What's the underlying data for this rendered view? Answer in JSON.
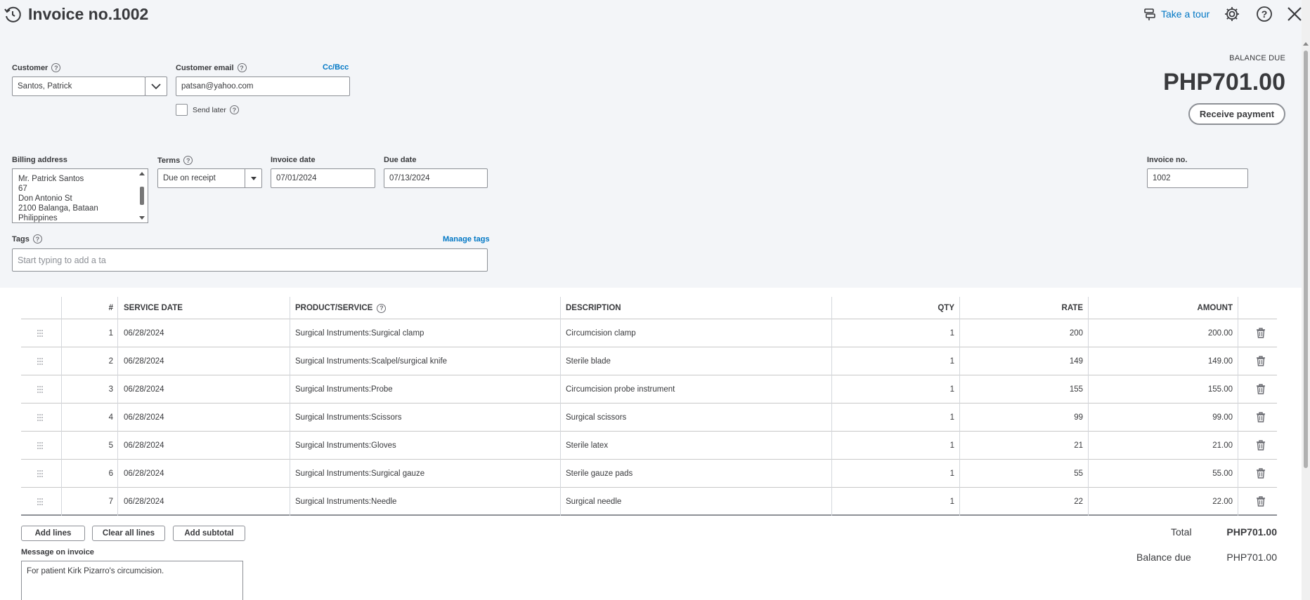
{
  "header": {
    "title": "Invoice no.1002",
    "tour_label": "Take a tour"
  },
  "customer": {
    "label": "Customer",
    "value": "Santos, Patrick"
  },
  "email": {
    "label": "Customer email",
    "value": "patsan@yahoo.com",
    "cc_bcc": "Cc/Bcc",
    "send_later": "Send later"
  },
  "balance": {
    "label": "BALANCE DUE",
    "amount": "PHP701.00",
    "receive_payment": "Receive payment"
  },
  "billing": {
    "label": "Billing address",
    "lines": [
      "Mr. Patrick Santos",
      "67",
      "Don Antonio St",
      "2100 Balanga, Bataan",
      "Philippines"
    ]
  },
  "terms": {
    "label": "Terms",
    "value": "Due on receipt"
  },
  "invoice_date": {
    "label": "Invoice date",
    "value": "07/01/2024"
  },
  "due_date": {
    "label": "Due date",
    "value": "07/13/2024"
  },
  "invoice_no": {
    "label": "Invoice no.",
    "value": "1002"
  },
  "tags": {
    "label": "Tags",
    "manage": "Manage tags",
    "placeholder": "Start typing to add a ta"
  },
  "table": {
    "headers": {
      "num": "#",
      "date": "SERVICE DATE",
      "product": "PRODUCT/SERVICE",
      "description": "DESCRIPTION",
      "qty": "QTY",
      "rate": "RATE",
      "amount": "AMOUNT"
    },
    "rows": [
      {
        "num": "1",
        "date": "06/28/2024",
        "product": "Surgical Instruments:Surgical clamp",
        "description": "Circumcision clamp",
        "qty": "1",
        "rate": "200",
        "amount": "200.00"
      },
      {
        "num": "2",
        "date": "06/28/2024",
        "product": "Surgical Instruments:Scalpel/surgical knife",
        "description": "Sterile blade",
        "qty": "1",
        "rate": "149",
        "amount": "149.00"
      },
      {
        "num": "3",
        "date": "06/28/2024",
        "product": "Surgical Instruments:Probe",
        "description": "Circumcision probe instrument",
        "qty": "1",
        "rate": "155",
        "amount": "155.00"
      },
      {
        "num": "4",
        "date": "06/28/2024",
        "product": "Surgical Instruments:Scissors",
        "description": "Surgical scissors",
        "qty": "1",
        "rate": "99",
        "amount": "99.00"
      },
      {
        "num": "5",
        "date": "06/28/2024",
        "product": "Surgical Instruments:Gloves",
        "description": "Sterile latex",
        "qty": "1",
        "rate": "21",
        "amount": "21.00"
      },
      {
        "num": "6",
        "date": "06/28/2024",
        "product": "Surgical Instruments:Surgical gauze",
        "description": "Sterile gauze pads",
        "qty": "1",
        "rate": "55",
        "amount": "55.00"
      },
      {
        "num": "7",
        "date": "06/28/2024",
        "product": "Surgical Instruments:Needle",
        "description": "Surgical needle",
        "qty": "1",
        "rate": "22",
        "amount": "22.00"
      }
    ]
  },
  "actions": {
    "add_lines": "Add lines",
    "clear_all": "Clear all lines",
    "add_subtotal": "Add subtotal"
  },
  "totals": {
    "total_label": "Total",
    "total_value": "PHP701.00",
    "balance_label": "Balance due",
    "balance_value": "PHP701.00"
  },
  "message": {
    "label": "Message on invoice",
    "value": "For patient Kirk Pizarro's circumcision."
  },
  "colors": {
    "accent": "#0077c5",
    "text": "#393a3d",
    "header_bg": "#f3f5f8"
  }
}
